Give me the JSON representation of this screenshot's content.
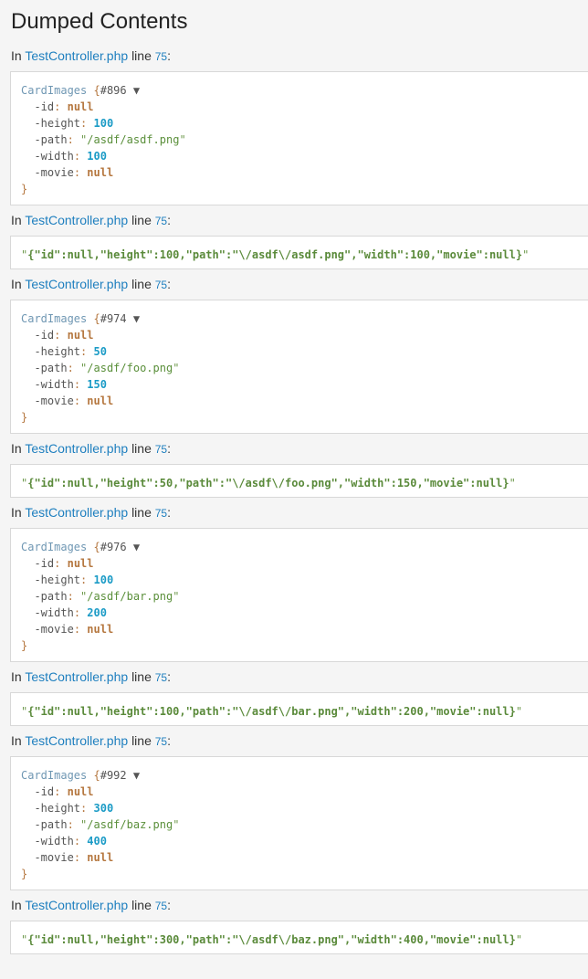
{
  "page": {
    "title": "Dumped Contents"
  },
  "location": {
    "prefix": "In",
    "file": "TestController.php",
    "line_word": "line",
    "line": "75",
    "suffix": ":"
  },
  "dumps": [
    {
      "kind": "object",
      "class": "CardImages",
      "open_brace": "{",
      "hash": "#896",
      "toggle": "▼",
      "close_brace": "}",
      "props": [
        {
          "name": "-id",
          "value": "null",
          "type": "null"
        },
        {
          "name": "-height",
          "value": "100",
          "type": "num"
        },
        {
          "name": "-path",
          "value": "/asdf/asdf.png",
          "type": "str"
        },
        {
          "name": "-width",
          "value": "100",
          "type": "num"
        },
        {
          "name": "-movie",
          "value": "null",
          "type": "null"
        }
      ]
    },
    {
      "kind": "string",
      "value": "{\"id\":null,\"height\":100,\"path\":\"\\/asdf\\/asdf.png\",\"width\":100,\"movie\":null}"
    },
    {
      "kind": "object",
      "class": "CardImages",
      "open_brace": "{",
      "hash": "#974",
      "toggle": "▼",
      "close_brace": "}",
      "props": [
        {
          "name": "-id",
          "value": "null",
          "type": "null"
        },
        {
          "name": "-height",
          "value": "50",
          "type": "num"
        },
        {
          "name": "-path",
          "value": "/asdf/foo.png",
          "type": "str"
        },
        {
          "name": "-width",
          "value": "150",
          "type": "num"
        },
        {
          "name": "-movie",
          "value": "null",
          "type": "null"
        }
      ]
    },
    {
      "kind": "string",
      "value": "{\"id\":null,\"height\":50,\"path\":\"\\/asdf\\/foo.png\",\"width\":150,\"movie\":null}"
    },
    {
      "kind": "object",
      "class": "CardImages",
      "open_brace": "{",
      "hash": "#976",
      "toggle": "▼",
      "close_brace": "}",
      "props": [
        {
          "name": "-id",
          "value": "null",
          "type": "null"
        },
        {
          "name": "-height",
          "value": "100",
          "type": "num"
        },
        {
          "name": "-path",
          "value": "/asdf/bar.png",
          "type": "str"
        },
        {
          "name": "-width",
          "value": "200",
          "type": "num"
        },
        {
          "name": "-movie",
          "value": "null",
          "type": "null"
        }
      ]
    },
    {
      "kind": "string",
      "value": "{\"id\":null,\"height\":100,\"path\":\"\\/asdf\\/bar.png\",\"width\":200,\"movie\":null}"
    },
    {
      "kind": "object",
      "class": "CardImages",
      "open_brace": "{",
      "hash": "#992",
      "toggle": "▼",
      "close_brace": "}",
      "props": [
        {
          "name": "-id",
          "value": "null",
          "type": "null"
        },
        {
          "name": "-height",
          "value": "300",
          "type": "num"
        },
        {
          "name": "-path",
          "value": "/asdf/baz.png",
          "type": "str"
        },
        {
          "name": "-width",
          "value": "400",
          "type": "num"
        },
        {
          "name": "-movie",
          "value": "null",
          "type": "null"
        }
      ]
    },
    {
      "kind": "string",
      "value": "{\"id\":null,\"height\":300,\"path\":\"\\/asdf\\/baz.png\",\"width\":400,\"movie\":null}"
    }
  ]
}
